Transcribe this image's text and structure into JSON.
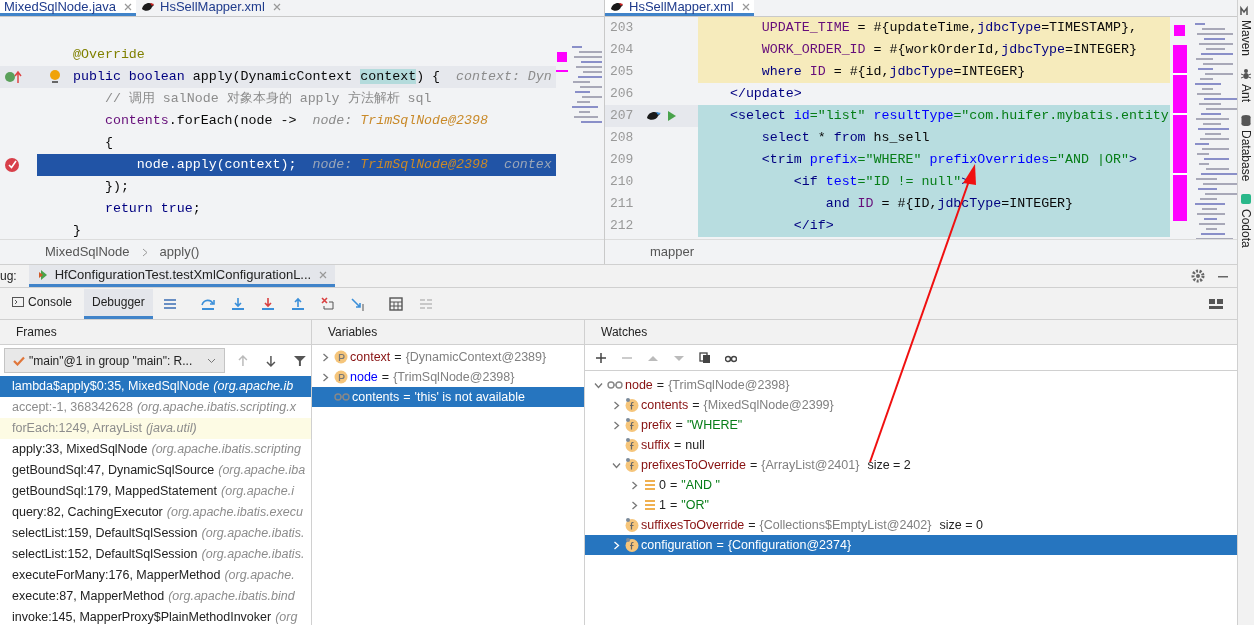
{
  "left_editor": {
    "tabs": [
      {
        "label": "MixedSqlNode.java",
        "selected": true
      },
      {
        "label": "HsSellMapper.xml",
        "selected": false,
        "kind": "mybatis"
      }
    ],
    "lines": [
      {
        "kind": "plain",
        "current": false,
        "caret": false,
        "segments": [
          {
            "text": "@Override",
            "kind": "annotation"
          }
        ]
      },
      {
        "kind": "override",
        "current": false,
        "caret": true,
        "segments": [
          {
            "text": "public ",
            "kind": "keyword"
          },
          {
            "text": "boolean ",
            "kind": "keyword"
          },
          {
            "text": "apply(DynamicContext ",
            "kind": "plain"
          },
          {
            "text": "context",
            "kind": "param_hl"
          },
          {
            "text": ") {",
            "kind": "plain"
          },
          {
            "text": "  context: Dyn",
            "kind": "hint"
          }
        ]
      },
      {
        "kind": "plain",
        "current": false,
        "caret": false,
        "segments": [
          {
            "text": "    // 调用 salNode 对象本身的 apply 方法解析 sql",
            "kind": "comment"
          }
        ]
      },
      {
        "kind": "plain",
        "current": false,
        "caret": false,
        "segments": [
          {
            "text": "    contents",
            "kind": "field"
          },
          {
            "text": ".forEach(node -> ",
            "kind": "plain"
          },
          {
            "text": " node: ",
            "kind": "hint"
          },
          {
            "text": "TrimSqlNode@2398",
            "kind": "hint_value"
          }
        ]
      },
      {
        "kind": "plain",
        "current": false,
        "caret": false,
        "segments": [
          {
            "text": "    {",
            "kind": "plain"
          }
        ]
      },
      {
        "kind": "breakpoint",
        "current": true,
        "caret": false,
        "segments": [
          {
            "text": "        node.apply(context);",
            "kind": "plain"
          },
          {
            "text": "  node: ",
            "kind": "hint"
          },
          {
            "text": "TrimSqlNode@2398",
            "kind": "hint_value"
          },
          {
            "text": "  contex",
            "kind": "hint"
          }
        ]
      },
      {
        "kind": "plain",
        "current": false,
        "caret": false,
        "segments": [
          {
            "text": "    });",
            "kind": "plain"
          }
        ]
      },
      {
        "kind": "plain",
        "current": false,
        "caret": false,
        "segments": [
          {
            "text": "    return ",
            "kind": "keyword"
          },
          {
            "text": "true",
            "kind": "keyword"
          },
          {
            "text": ";",
            "kind": "plain"
          }
        ]
      },
      {
        "kind": "plain",
        "current": false,
        "caret": false,
        "segments": [
          {
            "text": "}",
            "kind": "plain"
          }
        ]
      }
    ],
    "breadcrumbs": [
      "MixedSqlNode",
      "apply()"
    ]
  },
  "right_editor": {
    "tabs": [
      {
        "label": "HsSellMapper.xml",
        "selected": true,
        "kind": "mybatis"
      }
    ],
    "lines": [
      {
        "number": "203",
        "kind": "changed",
        "runnable": false,
        "segments": [
          {
            "text": "        UPDATE_TIME",
            "kind": "column"
          },
          {
            "text": " = #{updateTime,",
            "kind": "plain"
          },
          {
            "text": "jdbcType",
            "kind": "keyword"
          },
          {
            "text": "=TIMESTAMP},",
            "kind": "plain"
          }
        ]
      },
      {
        "number": "204",
        "kind": "changed",
        "runnable": false,
        "segments": [
          {
            "text": "        WORK_ORDER_ID",
            "kind": "column"
          },
          {
            "text": " = #{workOrderId,",
            "kind": "plain"
          },
          {
            "text": "jdbcType",
            "kind": "keyword"
          },
          {
            "text": "=INTEGER}",
            "kind": "plain"
          }
        ]
      },
      {
        "number": "205",
        "kind": "changed",
        "runnable": false,
        "segments": [
          {
            "text": "        where ",
            "kind": "keyword"
          },
          {
            "text": "ID",
            "kind": "column"
          },
          {
            "text": " = #{id,",
            "kind": "plain"
          },
          {
            "text": "jdbcType",
            "kind": "keyword"
          },
          {
            "text": "=INTEGER}",
            "kind": "plain"
          }
        ]
      },
      {
        "number": "206",
        "kind": "plain",
        "runnable": false,
        "segments": [
          {
            "text": "    </update>",
            "kind": "tag"
          }
        ]
      },
      {
        "number": "207",
        "kind": "block",
        "runnable": true,
        "segments": [
          {
            "text": "    <select ",
            "kind": "tag"
          },
          {
            "text": "id",
            "kind": "attr"
          },
          {
            "text": "=\"list\" ",
            "kind": "string"
          },
          {
            "text": "resultType",
            "kind": "attr"
          },
          {
            "text": "=\"com.huifer.mybatis.entity",
            "kind": "string"
          }
        ]
      },
      {
        "number": "208",
        "kind": "block",
        "runnable": false,
        "segments": [
          {
            "text": "        select",
            "kind": "keyword"
          },
          {
            "text": " * ",
            "kind": "plain"
          },
          {
            "text": "from",
            "kind": "keyword"
          },
          {
            "text": " hs_sell",
            "kind": "plain"
          }
        ]
      },
      {
        "number": "209",
        "kind": "block",
        "runnable": false,
        "segments": [
          {
            "text": "        <trim ",
            "kind": "tag"
          },
          {
            "text": "prefix",
            "kind": "attr"
          },
          {
            "text": "=\"WHERE\" ",
            "kind": "string"
          },
          {
            "text": "prefixOverrides",
            "kind": "attr"
          },
          {
            "text": "=\"AND |OR\"",
            "kind": "string"
          },
          {
            "text": ">",
            "kind": "tag"
          }
        ]
      },
      {
        "number": "210",
        "kind": "block",
        "runnable": false,
        "segments": [
          {
            "text": "            <if ",
            "kind": "tag"
          },
          {
            "text": "test",
            "kind": "attr"
          },
          {
            "text": "=\"ID != null\"",
            "kind": "string"
          },
          {
            "text": ">",
            "kind": "tag"
          }
        ]
      },
      {
        "number": "211",
        "kind": "block",
        "runnable": false,
        "segments": [
          {
            "text": "                and ",
            "kind": "keyword"
          },
          {
            "text": "ID",
            "kind": "column"
          },
          {
            "text": " = #{ID,",
            "kind": "plain"
          },
          {
            "text": "jdbcType",
            "kind": "keyword"
          },
          {
            "text": "=INTEGER}",
            "kind": "plain"
          }
        ]
      },
      {
        "number": "212",
        "kind": "block",
        "runnable": false,
        "segments": [
          {
            "text": "            </if>",
            "kind": "tag"
          }
        ]
      }
    ],
    "breadcrumbs": [
      "mapper"
    ]
  },
  "tool_windows": [
    {
      "label": "Maven",
      "kind": "maven"
    },
    {
      "label": "Ant",
      "kind": "ant"
    },
    {
      "label": "Database",
      "kind": "database"
    },
    {
      "label": "Codota",
      "kind": "codota"
    }
  ],
  "debug": {
    "label": "ug:",
    "session_tab": "HfConfigurationTest.testXmlConfigurationL...",
    "tabs": [
      {
        "label": "Console",
        "selected": false
      },
      {
        "label": "Debugger",
        "selected": true
      }
    ]
  },
  "frames": {
    "title": "Frames",
    "thread": "\"main\"@1 in group \"main\": R...",
    "items": [
      {
        "method": "lambda$apply$0:35, MixedSqlNode",
        "location": "(org.apache.ib",
        "selected": true
      },
      {
        "method": "accept:-1, 368342628",
        "location": "(org.apache.ibatis.scripting.x",
        "selected": false,
        "kind": "synthetic"
      },
      {
        "method": "forEach:1249, ArrayList",
        "location": "(java.util)",
        "selected": false,
        "kind": "library"
      },
      {
        "method": "apply:33, MixedSqlNode",
        "location": "(org.apache.ibatis.scripting",
        "selected": false,
        "kind": "normal"
      },
      {
        "method": "getBoundSql:47, DynamicSqlSource",
        "location": "(org.apache.iba",
        "selected": false,
        "kind": "normal"
      },
      {
        "method": "getBoundSql:179, MappedStatement",
        "location": "(org.apache.i",
        "selected": false,
        "kind": "normal"
      },
      {
        "method": "query:82, CachingExecutor",
        "location": "(org.apache.ibatis.execu",
        "selected": false,
        "kind": "normal"
      },
      {
        "method": "selectList:159, DefaultSqlSession",
        "location": "(org.apache.ibatis.",
        "selected": false,
        "kind": "normal"
      },
      {
        "method": "selectList:152, DefaultSqlSession",
        "location": "(org.apache.ibatis.",
        "selected": false,
        "kind": "normal"
      },
      {
        "method": "executeForMany:176, MapperMethod",
        "location": "(org.apache.",
        "selected": false,
        "kind": "normal"
      },
      {
        "method": "execute:87, MapperMethod",
        "location": "(org.apache.ibatis.bind",
        "selected": false,
        "kind": "normal"
      },
      {
        "method": "invoke:145, MapperProxy$PlainMethodInvoker",
        "location": "(org",
        "selected": false,
        "kind": "normal"
      }
    ]
  },
  "variables": {
    "title": "Variables",
    "items": [
      {
        "kind": "param",
        "name": "context",
        "op": "=",
        "value": {
          "text": "{DynamicContext@2389}",
          "kind": "ref"
        },
        "changed": false,
        "expanded": false,
        "selected": false
      },
      {
        "kind": "param",
        "name": "node",
        "op": "=",
        "value": {
          "text": "{TrimSqlNode@2398}",
          "kind": "ref"
        },
        "changed": true,
        "expanded": false,
        "selected": false
      },
      {
        "kind": "watch",
        "name": "contents",
        "op": "=",
        "value": {
          "text": "'this' is not available"
        },
        "selected": true
      }
    ]
  },
  "watches": {
    "title": "Watches",
    "items": [
      {
        "kind": "watch",
        "name": "node",
        "op": "=",
        "value": {
          "text": "{TrimSqlNode@2398}",
          "kind": "ref"
        },
        "expanded": true,
        "selected": false,
        "children": [
          {
            "kind": "field",
            "name": "contents",
            "op": "=",
            "value": {
              "text": "{MixedSqlNode@2399}",
              "kind": "ref"
            },
            "expanded": false,
            "selected": false
          },
          {
            "kind": "field",
            "name": "prefix",
            "op": "=",
            "value": {
              "text": "\"WHERE\"",
              "kind": "string"
            },
            "expanded": false,
            "selected": false
          },
          {
            "kind": "field",
            "name": "suffix",
            "op": "=",
            "value": {
              "text": "null",
              "kind": "plain"
            },
            "selected": false
          },
          {
            "kind": "field",
            "name": "prefixesToOverride",
            "op": "=",
            "value": {
              "text": "{ArrayList@2401}",
              "kind": "ref"
            },
            "extra": "size = 2",
            "expanded": true,
            "selected": false,
            "children": [
              {
                "kind": "element",
                "name": "0",
                "op": "=",
                "value": {
                  "text": "\"AND \"",
                  "kind": "string"
                },
                "expanded": false,
                "selected": false
              },
              {
                "kind": "element",
                "name": "1",
                "op": "=",
                "value": {
                  "text": "\"OR\"",
                  "kind": "string"
                },
                "expanded": false,
                "selected": false
              }
            ]
          },
          {
            "kind": "field",
            "name": "suffixesToOverride",
            "op": "=",
            "value": {
              "text": "{Collections$EmptyList@2402}",
              "kind": "ref"
            },
            "extra": "size = 0",
            "selected": false
          },
          {
            "kind": "field",
            "name": "configuration",
            "op": "=",
            "value": {
              "text": "{Configuration@2374}"
            },
            "expanded": false,
            "selected": true
          }
        ]
      }
    ]
  }
}
